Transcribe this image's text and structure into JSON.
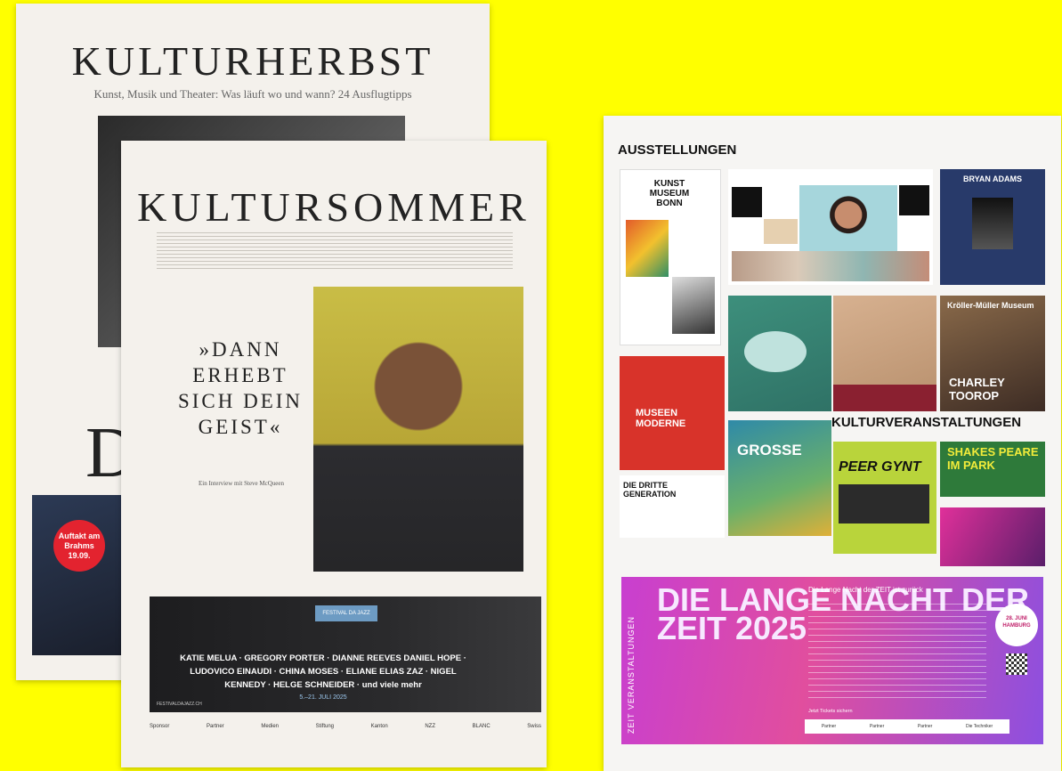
{
  "back_paper": {
    "masthead": "KULTURHERBST",
    "subtitle": "Kunst, Musik und Theater: Was läuft wo und wann? 24 Ausflugtipps",
    "big_letter": "D",
    "badge": "Auftakt am Brahms 19.09."
  },
  "front_paper": {
    "masthead": "KULTURSOMMER",
    "quote": "»DANN ERHEBT SICH DEIN GEIST«",
    "deck": "Ein Interview mit Steve McQueen",
    "ad": {
      "tag": "FESTIVAL DA JAZZ",
      "names": "KATIE MELUA · GREGORY PORTER · DIANNE REEVES DANIEL HOPE · LUDOVICO EINAUDI · CHINA MOSES · ELIANE ELIAS ZAZ · NIGEL KENNEDY · HELGE SCHNEIDER · und viele mehr",
      "dates": "5.–21. JULI 2025",
      "url": "FESTIVALDAJAZZ.CH"
    },
    "logos": [
      "Sponsor",
      "Partner",
      "Medien",
      "Stiftung",
      "Kanton",
      "NZZ",
      "BLANC",
      "Swiss"
    ]
  },
  "right_page": {
    "heading": "AUSSTELLUNGEN",
    "heading2": "KULTURVERANSTALTUNGEN",
    "tiles": {
      "kunstmuseum": "KUNST MUSEUM BONN",
      "bryan": "BRYAN ADAMS",
      "museen": "MUSEEN MODERNE",
      "kroller": "Kröller-Müller Museum",
      "charley": "CHARLEY TOOROP",
      "grosse": "GROSSE",
      "peer": "PEER GYNT",
      "shakes": "SHAKES PEARE IM PARK",
      "generation": "DIE DRITTE GENERATION"
    },
    "lange": {
      "title": "DIE LANGE NACHT DER ZEIT 2025",
      "vertical": "ZEIT VERANSTALTUNGEN",
      "headline": "Die Lange Nacht der ZEIT ist zurück",
      "badge": "28. JUNI HAMBURG",
      "note": "Jetzt Tickets sichern",
      "logos": [
        "Partner",
        "Partner",
        "Partner",
        "Die Techniker"
      ]
    }
  },
  "colors": {
    "background": "#ffff00",
    "accent": "#c0206a"
  }
}
